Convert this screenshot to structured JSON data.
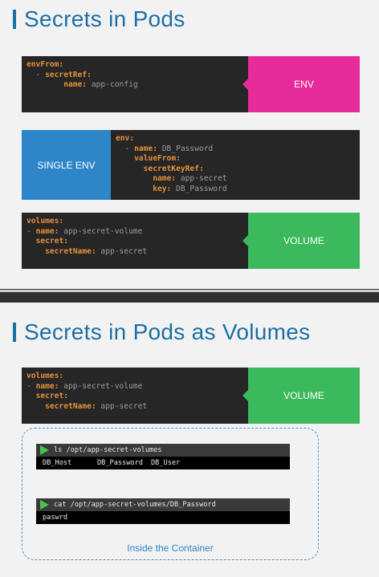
{
  "slide1": {
    "title": "Secrets in Pods",
    "block_env": {
      "lines": [
        {
          "indent": "",
          "key": "envFrom:",
          "value": ""
        },
        {
          "indent": "  - ",
          "key": "secretRef:",
          "value": ""
        },
        {
          "indent": "        ",
          "key": "name:",
          "value": " app-config"
        }
      ],
      "tag": "ENV"
    },
    "block_single": {
      "lines": [
        {
          "indent": "",
          "key": "env:",
          "value": ""
        },
        {
          "indent": "  - ",
          "key": "name:",
          "value": " DB_Password"
        },
        {
          "indent": "    ",
          "key": "valueFrom:",
          "value": ""
        },
        {
          "indent": "      ",
          "key": "secretKeyRef:",
          "value": ""
        },
        {
          "indent": "        ",
          "key": "name:",
          "value": " app-secret"
        },
        {
          "indent": "        ",
          "key": "key:",
          "value": " DB_Password"
        }
      ],
      "tag": "SINGLE ENV"
    },
    "block_volume": {
      "lines": [
        {
          "indent": "",
          "key": "volumes:",
          "value": ""
        },
        {
          "indent": "- ",
          "key": "name:",
          "value": " app-secret-volume"
        },
        {
          "indent": "  ",
          "key": "secret:",
          "value": ""
        },
        {
          "indent": "    ",
          "key": "secretName:",
          "value": " app-secret"
        }
      ],
      "tag": "VOLUME"
    }
  },
  "slide2": {
    "title": "Secrets in Pods as Volumes",
    "block_volume": {
      "lines": [
        {
          "indent": "",
          "key": "volumes:",
          "value": ""
        },
        {
          "indent": "- ",
          "key": "name:",
          "value": " app-secret-volume"
        },
        {
          "indent": "  ",
          "key": "secret:",
          "value": ""
        },
        {
          "indent": "    ",
          "key": "secretName:",
          "value": " app-secret"
        }
      ],
      "tag": "VOLUME"
    },
    "terminal1": {
      "command": "ls /opt/app-secret-volumes",
      "output": [
        "DB_Host",
        "DB_Password",
        "DB_User"
      ]
    },
    "terminal2": {
      "command": "cat /opt/app-secret-volumes/DB_Password",
      "output": [
        "paswrd"
      ]
    },
    "container_label": "Inside the Container"
  },
  "colors": {
    "title": "#1d6fa5",
    "code_bg": "#262626",
    "code_key": "#e6903a",
    "env_tag": "#e62c9a",
    "single_env_tag": "#2e86c9",
    "volume_tag": "#3cb95c",
    "play_icon": "#4ac24a"
  }
}
